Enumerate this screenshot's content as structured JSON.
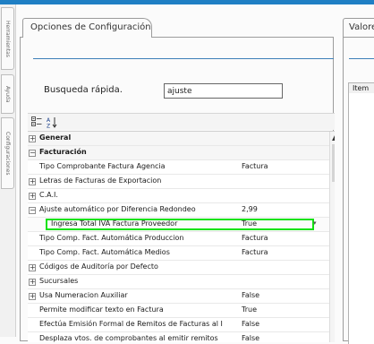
{
  "side_tabs": [
    "Herramientas",
    "Ayuda",
    "Configuraciones"
  ],
  "main_tab": {
    "label": "Opciones de Configuración"
  },
  "search": {
    "label": "Busqueda rápida.",
    "value": "ajuste"
  },
  "toolbar": {
    "categorized_icon": "categorized-icon",
    "sort_az_icon": "sort-az-icon"
  },
  "properties": [
    {
      "type": "category",
      "expander": "+",
      "name": "General",
      "value": ""
    },
    {
      "type": "category",
      "expander": "−",
      "name": "Facturación",
      "value": ""
    },
    {
      "type": "item",
      "expander": "",
      "name": "Tipo Comprobante Factura Agencia",
      "value": "Factura"
    },
    {
      "type": "group",
      "expander": "+",
      "name": "Letras de Facturas de Exportacion",
      "value": ""
    },
    {
      "type": "group",
      "expander": "+",
      "name": "C.A.I.",
      "value": ""
    },
    {
      "type": "group",
      "expander": "−",
      "name": "Ajuste automático por Diferencia Redondeo",
      "value": "2,99"
    },
    {
      "type": "edit",
      "expander": "",
      "name": "Ingresa Total IVA Factura Proveedor",
      "value": "True"
    },
    {
      "type": "item",
      "expander": "",
      "name": "Tipo Comp. Fact. Automática Produccion",
      "value": "Factura"
    },
    {
      "type": "item",
      "expander": "",
      "name": "Tipo Comp. Fact. Automática Medios",
      "value": "Factura"
    },
    {
      "type": "group",
      "expander": "+",
      "name": "Códigos de Auditoría por Defecto",
      "value": ""
    },
    {
      "type": "group",
      "expander": "+",
      "name": "Sucursales",
      "value": ""
    },
    {
      "type": "group",
      "expander": "+",
      "name": "Usa Numeracion Auxiliar",
      "value": "False"
    },
    {
      "type": "item",
      "expander": "",
      "name": "Permite modificar texto en Factura",
      "value": "True"
    },
    {
      "type": "item",
      "expander": "",
      "name": "Efectúa Emisión Formal de Remitos de Facturas al I",
      "value": "False"
    },
    {
      "type": "item",
      "expander": "",
      "name": "Desplaza vtos. de comprobantes al emitir remitos",
      "value": "False"
    }
  ],
  "right_panel": {
    "tab_label": "Valore",
    "column_header": "Item"
  },
  "colors": {
    "accent": "#1f7fc4",
    "highlight": "#11e211"
  }
}
